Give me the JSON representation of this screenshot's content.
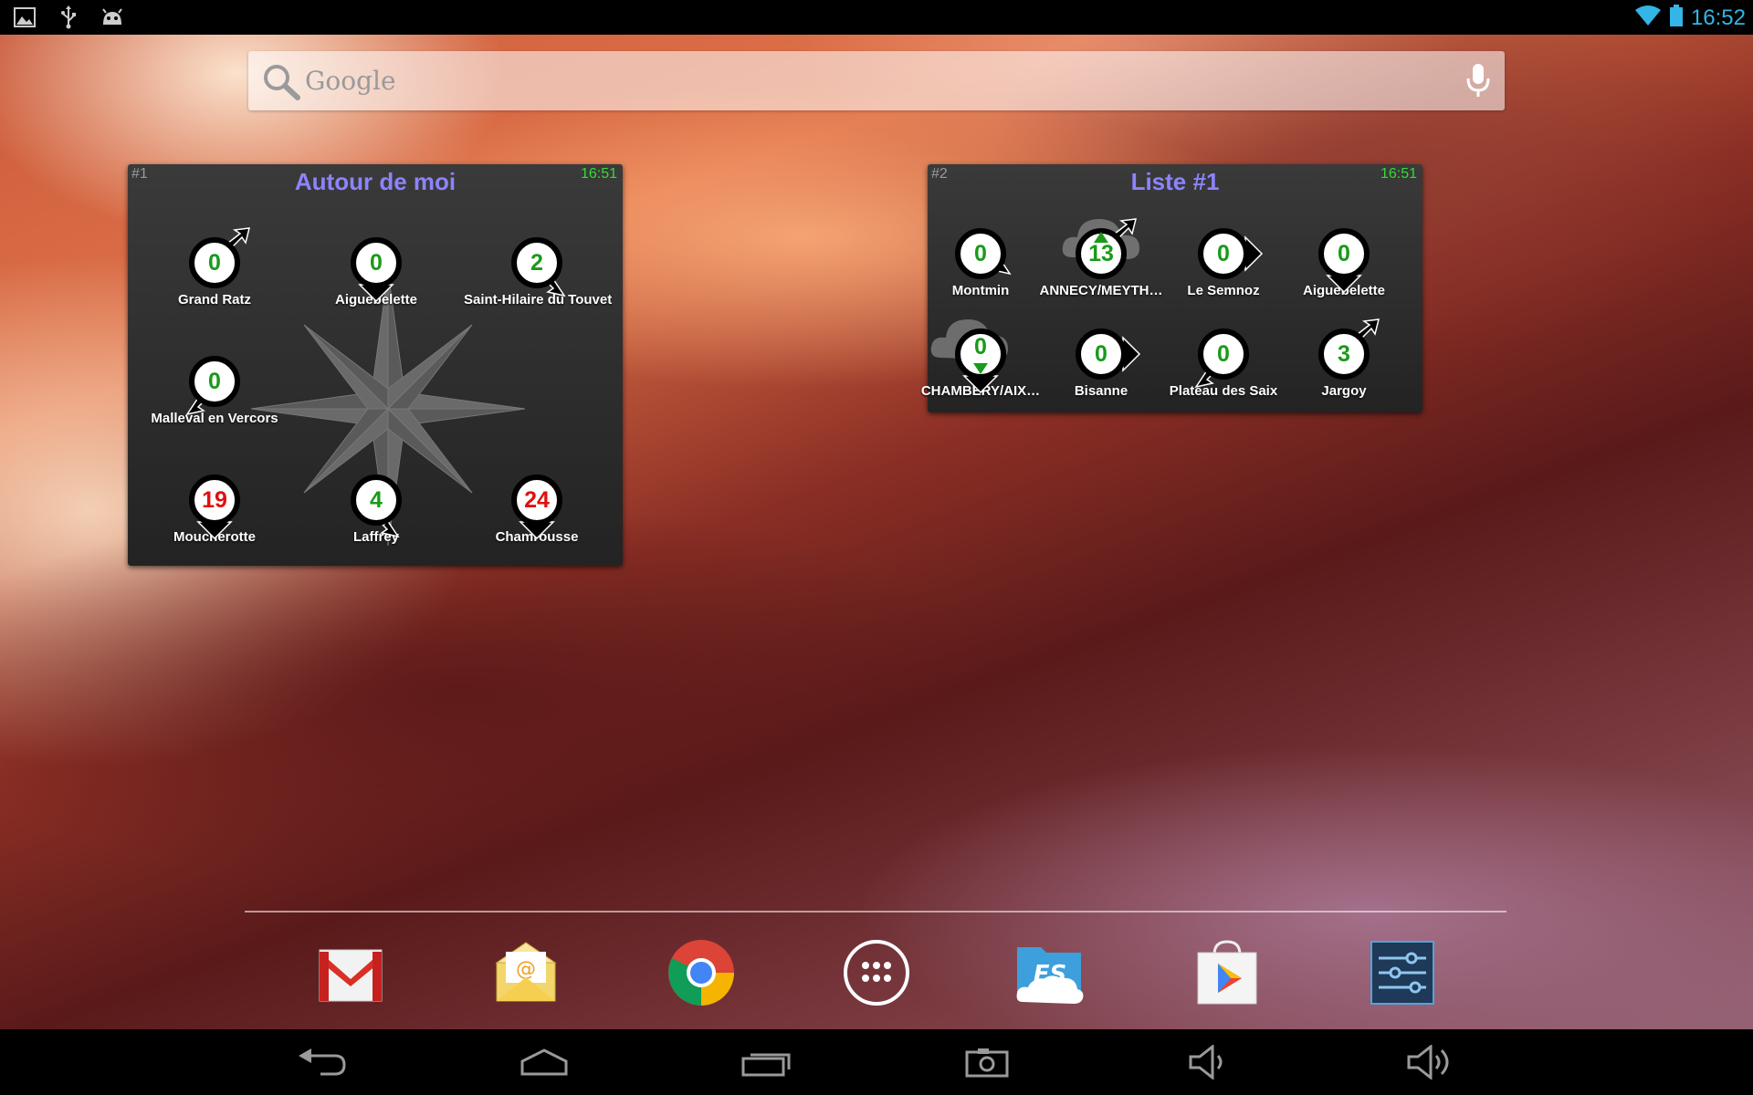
{
  "status_bar": {
    "left_icons": [
      "gallery-icon",
      "usb-icon",
      "android-debug-icon"
    ],
    "right_icons": [
      "wifi-icon",
      "battery-icon"
    ],
    "time": "16:52"
  },
  "search": {
    "placeholder": "Google",
    "icons": [
      "search-icon",
      "mic-icon"
    ]
  },
  "widget1": {
    "number": "#1",
    "title": "Autour de moi",
    "time": "16:51",
    "stations": [
      {
        "name": "Grand Ratz",
        "value": "0",
        "color": "green",
        "direction": "NE"
      },
      {
        "name": "Aiguebelette",
        "value": "0",
        "color": "green",
        "direction": "S"
      },
      {
        "name": "Saint-Hilaire du Touvet",
        "value": "2",
        "color": "green",
        "direction": "SE"
      },
      {
        "name": "Malleval en Vercors",
        "value": "0",
        "color": "green",
        "direction": "SW"
      },
      {
        "name": "Moucherotte",
        "value": "19",
        "color": "red",
        "direction": "S"
      },
      {
        "name": "Laffrey",
        "value": "4",
        "color": "green",
        "direction": "SE"
      },
      {
        "name": "Chamrousse",
        "value": "24",
        "color": "red",
        "direction": "S"
      }
    ]
  },
  "widget2": {
    "number": "#2",
    "title": "Liste #1",
    "time": "16:51",
    "stations": [
      {
        "name": "Montmin",
        "value": "0",
        "color": "green",
        "direction": "SE"
      },
      {
        "name": "ANNECY/MEYTH…",
        "value": "13",
        "color": "green",
        "direction": "NE",
        "trend": "up"
      },
      {
        "name": "Le Semnoz",
        "value": "0",
        "color": "green",
        "direction": "E"
      },
      {
        "name": "Aiguebelette",
        "value": "0",
        "color": "green",
        "direction": "S"
      },
      {
        "name": "CHAMBERY/AIX…",
        "value": "0",
        "color": "green",
        "direction": "S",
        "trend": "down"
      },
      {
        "name": "Bisanne",
        "value": "0",
        "color": "green",
        "direction": "E"
      },
      {
        "name": "Plateau des Saix",
        "value": "0",
        "color": "green",
        "direction": "SW"
      },
      {
        "name": "Jargoy",
        "value": "3",
        "color": "green",
        "direction": "NE"
      }
    ]
  },
  "dock": [
    "gmail-icon",
    "email-icon",
    "chrome-icon",
    "app-drawer-icon",
    "es-file-explorer-icon",
    "play-store-icon",
    "settings-icon"
  ],
  "nav": [
    "back-icon",
    "home-icon",
    "recent-apps-icon",
    "screenshot-icon",
    "volume-down-icon",
    "volume-up-icon"
  ]
}
